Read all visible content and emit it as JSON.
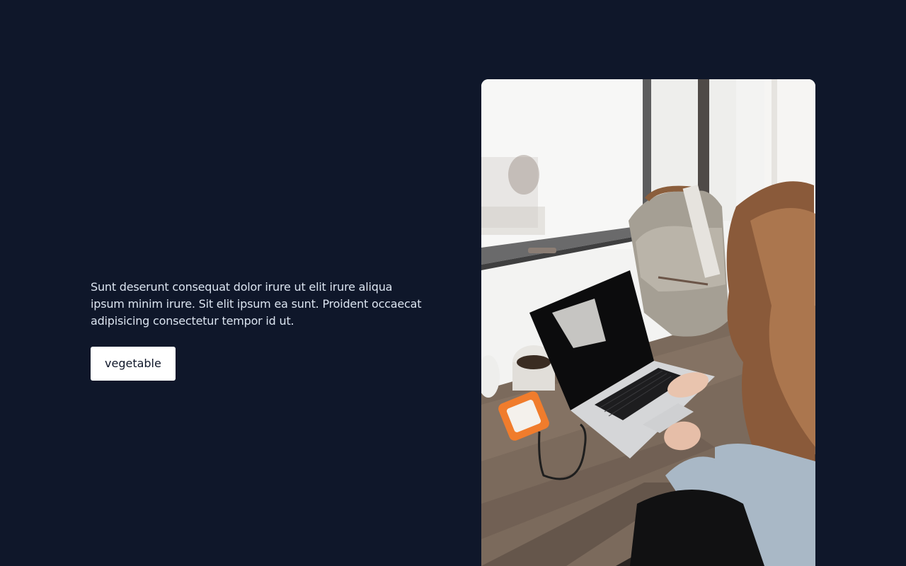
{
  "hero": {
    "description": "Sunt deserunt consequat dolor irure ut elit irure aliqua ipsum minim irure. Sit elit ipsum ea sunt. Proident occaecat adipisicing consectetur tempor id ut.",
    "button_label": "vegetable"
  },
  "colors": {
    "background": "#0f172a",
    "text": "#dbe4f0",
    "button_bg": "#ffffff",
    "button_text": "#0f172a"
  },
  "image": {
    "subject": "woman-typing-on-laptop-at-window-desk"
  }
}
